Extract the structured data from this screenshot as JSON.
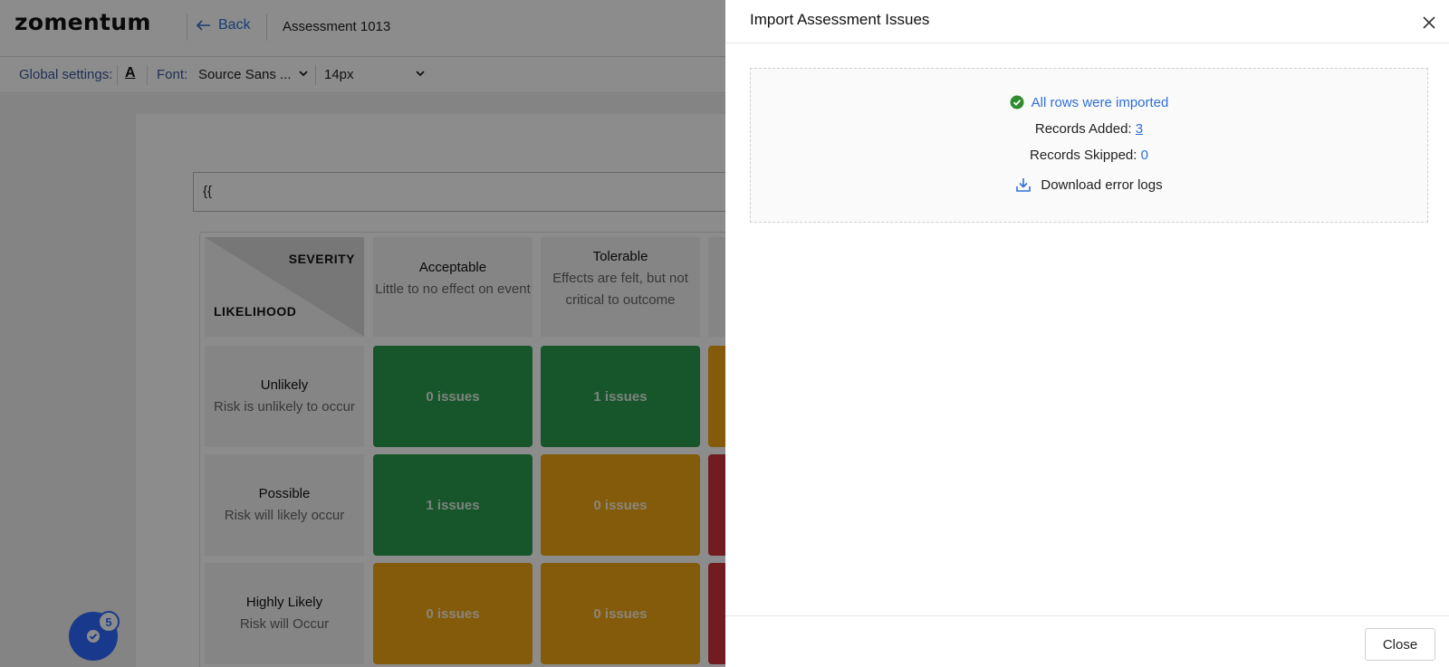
{
  "app": {
    "logo": "zomentum",
    "back_label": "Back",
    "assessment_title": "Assessment 1013"
  },
  "settings": {
    "global_label": "Global settings:",
    "font_label": "Font:",
    "font_value": "Source Sans ...",
    "size_value": "14px"
  },
  "editor": {
    "formula_text": "{{"
  },
  "matrix": {
    "corner_severity": "SEVERITY",
    "corner_likelihood": "LIKELIHOOD",
    "columns": [
      {
        "title": "Acceptable",
        "desc": "Little to no effect on event"
      },
      {
        "title": "Tolerable",
        "desc": "Effects are felt, but not critical to outcome"
      }
    ],
    "rows": [
      {
        "title": "Unlikely",
        "desc": "Risk is unlikely to occur",
        "cells": [
          "0 issues",
          "1 issues"
        ]
      },
      {
        "title": "Possible",
        "desc": "Risk will likely occur",
        "cells": [
          "1 issues",
          "0 issues"
        ]
      },
      {
        "title": "Highly Likely",
        "desc": "Risk will Occur",
        "cells": [
          "0 issues",
          "0 issues"
        ]
      }
    ],
    "colors": {
      "green": "#2a9d4e",
      "amber": "#f0a615",
      "red": "#d0343f"
    }
  },
  "helper": {
    "badge_count": "5"
  },
  "drawer": {
    "title": "Import Assessment Issues",
    "status": "All rows were imported",
    "records_added_label": "Records Added:",
    "records_added_value": "3",
    "records_skipped_label": "Records Skipped:",
    "records_skipped_value": "0",
    "download_label": "Download error logs",
    "close_button": "Close",
    "colors": {
      "success": "#2e8b2e",
      "link": "#2f6fd6"
    }
  }
}
